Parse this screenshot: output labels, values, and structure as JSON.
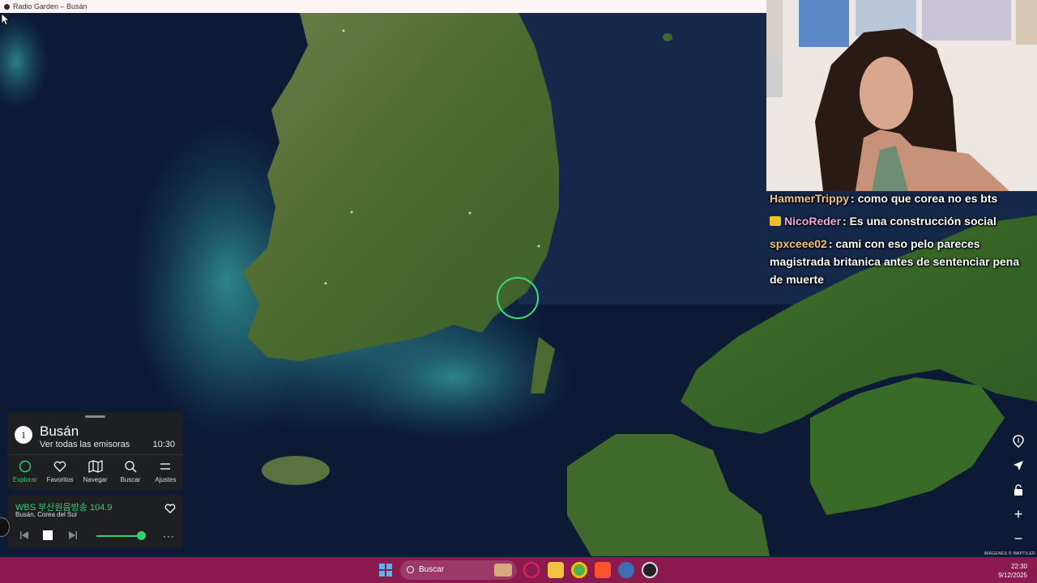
{
  "window": {
    "title": "Radio Garden – Busán"
  },
  "chat": [
    {
      "user": "HammerTrippy",
      "color": "#f2c878",
      "message": ": como que corea no es bts",
      "badge": false
    },
    {
      "user": "NicoReder",
      "color": "#f0a8e0",
      "message": ": Es una construcción social",
      "badge": true
    },
    {
      "user": "spxceee02",
      "color": "#f2c878",
      "message": ": cami con eso pelo pareces magistrada britanica antes de sentenciar pena de muerte",
      "badge": false
    }
  ],
  "panel": {
    "count": "1",
    "city": "Busán",
    "subtitle": "Ver todas las emisoras",
    "time": "10:30",
    "nav": [
      {
        "label": "Explorar",
        "icon": "explore-icon",
        "active": true
      },
      {
        "label": "Favoritos",
        "icon": "heart-icon",
        "active": false
      },
      {
        "label": "Navegar",
        "icon": "map-icon",
        "active": false
      },
      {
        "label": "Buscar",
        "icon": "search-icon",
        "active": false
      },
      {
        "label": "Ajustes",
        "icon": "menu-icon",
        "active": false
      }
    ]
  },
  "player": {
    "station": "WBS 부산원음방송 104.9",
    "location": "Busán, Corea del Sur",
    "volume": 0.95,
    "more": "···"
  },
  "map_controls": {
    "zoom_in": "+",
    "zoom_out": "−"
  },
  "attribution": "IMÁGENES © MAPTILER",
  "taskbar": {
    "search_placeholder": "Buscar",
    "time": "22:30",
    "date": "9/12/2025"
  },
  "colors": {
    "accent": "#2ed36c",
    "taskbar": "#8b1a4e",
    "panel": "#1d1f22"
  }
}
